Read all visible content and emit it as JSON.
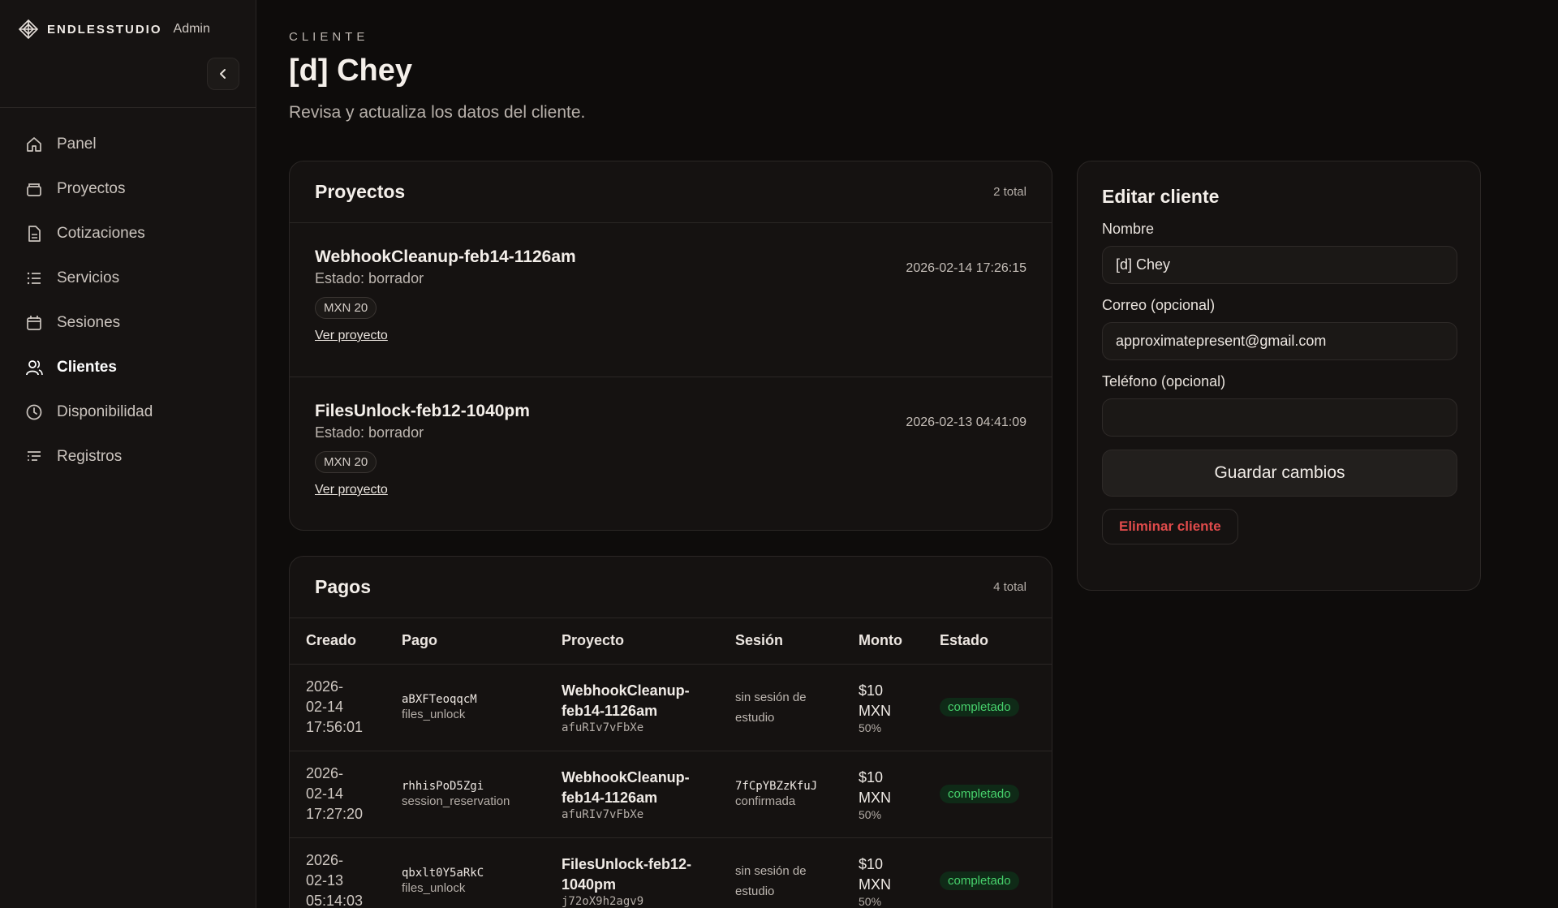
{
  "brand": {
    "name": "ENDLESSTUDIO",
    "sub": "Admin"
  },
  "sidebar": {
    "items": [
      {
        "label": "Panel",
        "icon": "home-icon"
      },
      {
        "label": "Proyectos",
        "icon": "folder-icon"
      },
      {
        "label": "Cotizaciones",
        "icon": "document-icon"
      },
      {
        "label": "Servicios",
        "icon": "list-icon"
      },
      {
        "label": "Sesiones",
        "icon": "calendar-icon"
      },
      {
        "label": "Clientes",
        "icon": "users-icon",
        "active": true
      },
      {
        "label": "Disponibilidad",
        "icon": "clock-icon"
      },
      {
        "label": "Registros",
        "icon": "log-icon"
      }
    ]
  },
  "header": {
    "eyebrow": "CLIENTE",
    "title": "[d] Chey",
    "subtitle": "Revisa y actualiza los datos del cliente."
  },
  "projects": {
    "title": "Proyectos",
    "count": "2 total",
    "items": [
      {
        "name": "WebhookCleanup-feb14-1126am",
        "status": "Estado: borrador",
        "date": "2026-02-14 17:26:15",
        "badge": "MXN 20",
        "link": "Ver proyecto"
      },
      {
        "name": "FilesUnlock-feb12-1040pm",
        "status": "Estado: borrador",
        "date": "2026-02-13 04:41:09",
        "badge": "MXN 20",
        "link": "Ver proyecto"
      }
    ]
  },
  "payments": {
    "title": "Pagos",
    "count": "4 total",
    "columns": [
      "Creado",
      "Pago",
      "Proyecto",
      "Sesión",
      "Monto",
      "Estado"
    ],
    "rows": [
      {
        "created": [
          "2026-",
          "02-14",
          "17:56:01"
        ],
        "pay_id": "aBXFTeoqqcM",
        "pay_type": "files_unlock",
        "project": [
          "WebhookCleanup-",
          "feb14-1126am"
        ],
        "project_id": "afuRIv7vFbXe",
        "session": [
          "sin sesión de",
          "estudio"
        ],
        "session_id": "",
        "amount": [
          "$10",
          "MXN"
        ],
        "pct": "50%",
        "status": "completado"
      },
      {
        "created": [
          "2026-",
          "02-14",
          "17:27:20"
        ],
        "pay_id": "rhhisPoD5Zgi",
        "pay_type": "session_reservation",
        "project": [
          "WebhookCleanup-",
          "feb14-1126am"
        ],
        "project_id": "afuRIv7vFbXe",
        "session": [
          "",
          "confirmada"
        ],
        "session_id": "7fCpYBZzKfuJ",
        "amount": [
          "$10",
          "MXN"
        ],
        "pct": "50%",
        "status": "completado"
      },
      {
        "created": [
          "2026-",
          "02-13",
          "05:14:03"
        ],
        "pay_id": "qbxlt0Y5aRkC",
        "pay_type": "files_unlock",
        "project": [
          "FilesUnlock-feb12-",
          "1040pm"
        ],
        "project_id": "j72oX9h2agv9",
        "session": [
          "sin sesión de",
          "estudio"
        ],
        "session_id": "",
        "amount": [
          "$10",
          "MXN"
        ],
        "pct": "50%",
        "status": "completado"
      }
    ]
  },
  "edit": {
    "title": "Editar cliente",
    "name_label": "Nombre",
    "name_value": "[d] Chey",
    "email_label": "Correo (opcional)",
    "email_value": "approximatepresent@gmail.com",
    "phone_label": "Teléfono (opcional)",
    "phone_value": "",
    "save_label": "Guardar cambios",
    "delete_label": "Eliminar cliente"
  },
  "colors": {
    "accent_green": "#47d16c",
    "danger": "#e04b4b",
    "bg": "#0e0c0b"
  }
}
